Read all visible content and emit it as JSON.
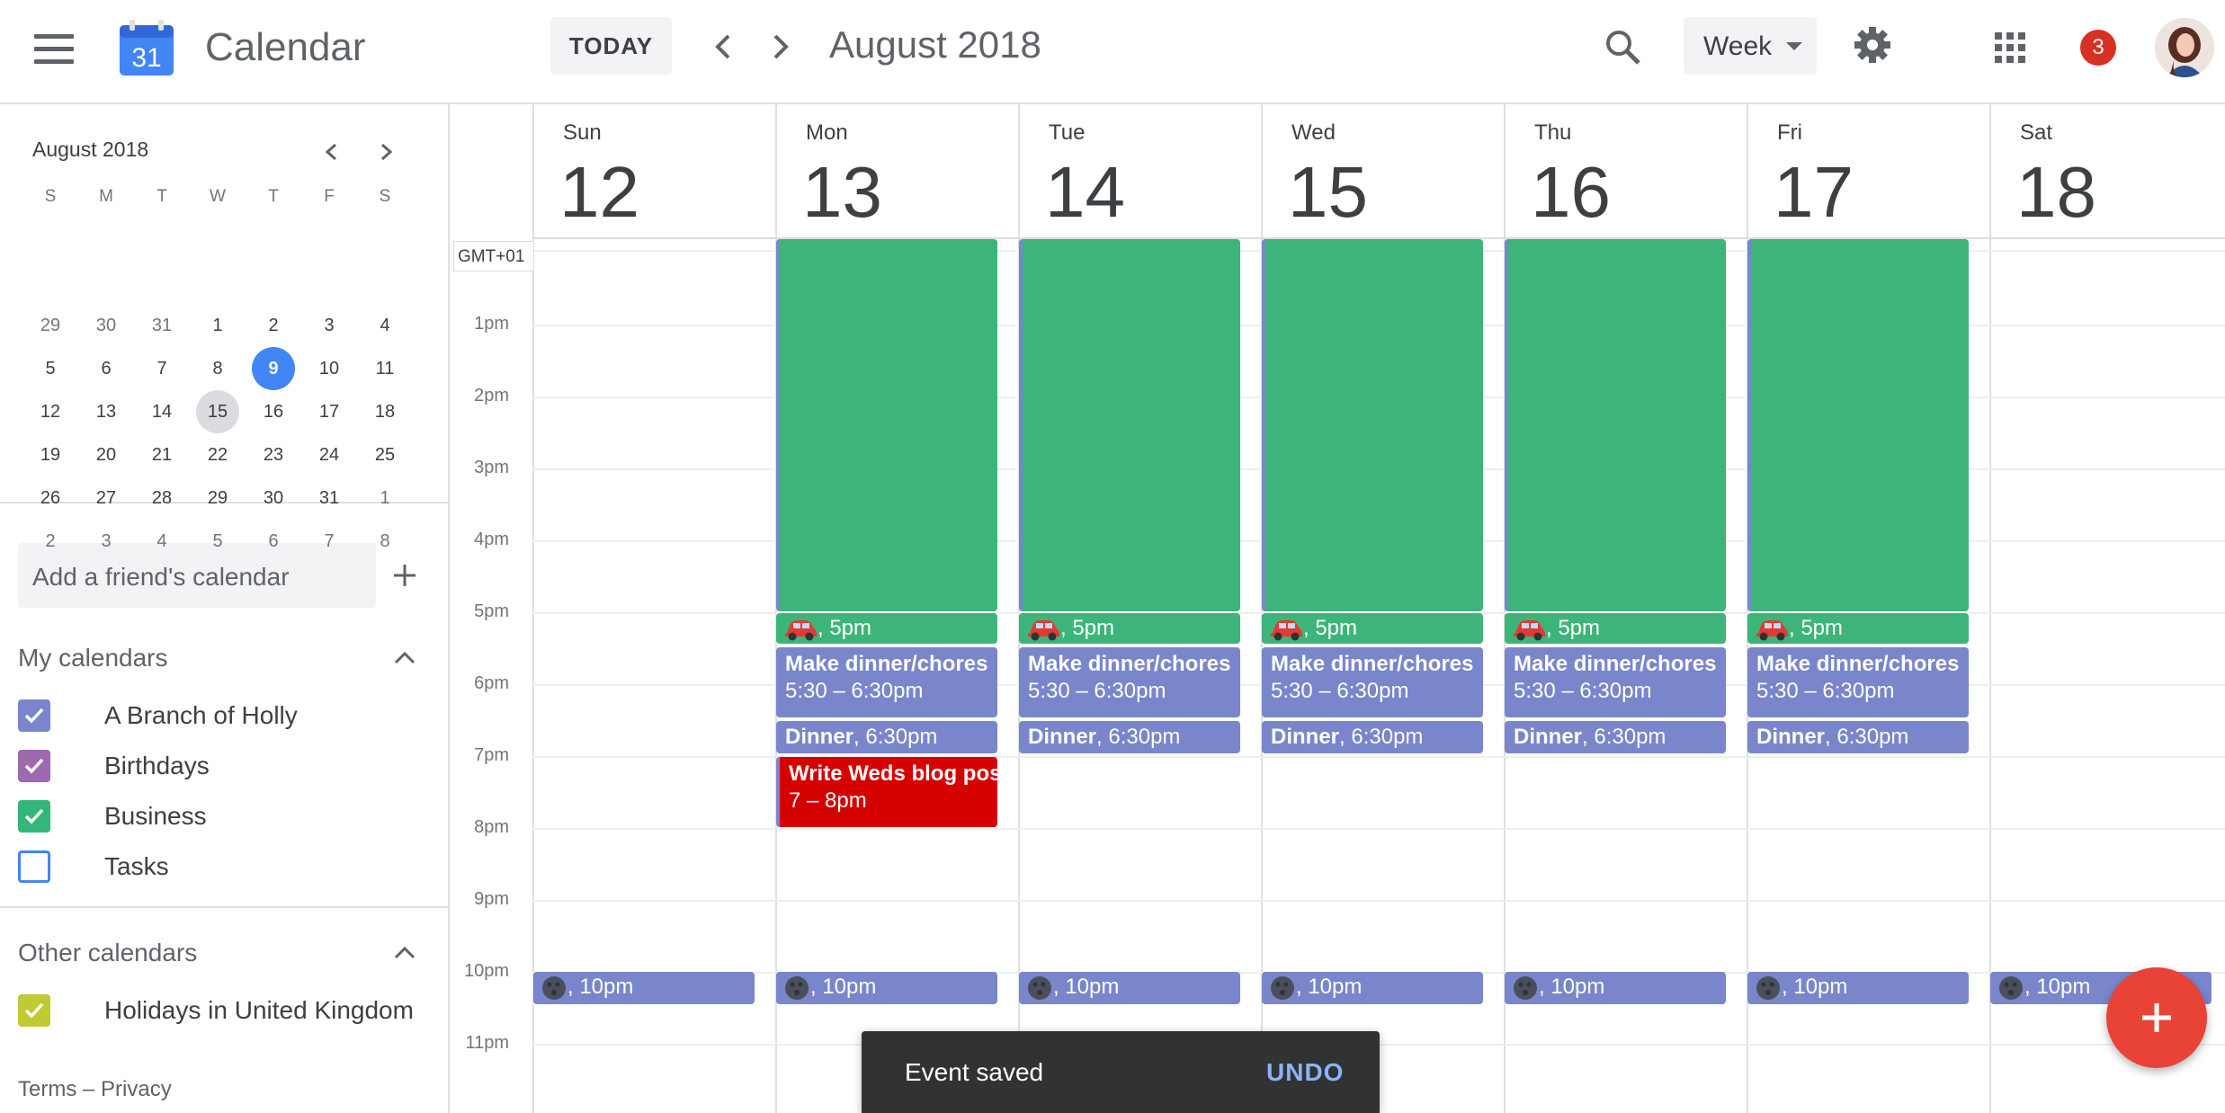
{
  "header": {
    "app_title": "Calendar",
    "logo_day": "31",
    "today_label": "TODAY",
    "date_range": "August 2018",
    "view_selected": "Week",
    "notification_count": "3"
  },
  "sidebar": {
    "mini_calendar": {
      "month_label": "August 2018",
      "weekday_headers": [
        "S",
        "M",
        "T",
        "W",
        "T",
        "F",
        "S"
      ],
      "weeks": [
        [
          "29",
          "30",
          "31",
          "1",
          "2",
          "3",
          "4"
        ],
        [
          "5",
          "6",
          "7",
          "8",
          "9",
          "10",
          "11"
        ],
        [
          "12",
          "13",
          "14",
          "15",
          "16",
          "17",
          "18"
        ],
        [
          "19",
          "20",
          "21",
          "22",
          "23",
          "24",
          "25"
        ],
        [
          "26",
          "27",
          "28",
          "29",
          "30",
          "31",
          "1"
        ],
        [
          "2",
          "3",
          "4",
          "5",
          "6",
          "7",
          "8"
        ]
      ],
      "today": "9",
      "current": "15"
    },
    "add_friend_placeholder": "Add a friend's calendar",
    "my_calendars_title": "My calendars",
    "my_calendars": [
      {
        "label": "A Branch of Holly",
        "color": "#7986cb",
        "checked": true
      },
      {
        "label": "Birthdays",
        "color": "#9e69af",
        "checked": true
      },
      {
        "label": "Business",
        "color": "#33b679",
        "checked": true
      },
      {
        "label": "Tasks",
        "color": "#4285f4",
        "checked": false
      }
    ],
    "other_calendars_title": "Other calendars",
    "other_calendars": [
      {
        "label": "Holidays in United Kingdom",
        "color": "#c0ca33",
        "checked": true
      }
    ],
    "footer": "Terms – Privacy"
  },
  "grid": {
    "timezone": "GMT+01",
    "days": [
      {
        "name": "Sun",
        "num": "12"
      },
      {
        "name": "Mon",
        "num": "13"
      },
      {
        "name": "Tue",
        "num": "14"
      },
      {
        "name": "Wed",
        "num": "15"
      },
      {
        "name": "Thu",
        "num": "16"
      },
      {
        "name": "Fri",
        "num": "17"
      },
      {
        "name": "Sat",
        "num": "18"
      }
    ],
    "hours": [
      "1pm",
      "2pm",
      "3pm",
      "4pm",
      "5pm",
      "6pm",
      "7pm",
      "8pm",
      "9pm",
      "10pm",
      "11pm"
    ],
    "events": {
      "car_time": ", 5pm",
      "chores_title": "Make dinner/chores",
      "chores_time": "5:30 – 6:30pm",
      "dinner_title": "Dinner",
      "dinner_time": ", 6:30pm",
      "blog_title": "Write Weds blog post",
      "blog_time": "7 – 8pm",
      "night_time": ", 10pm"
    }
  },
  "toast": {
    "message": "Event saved",
    "action": "UNDO"
  },
  "colors": {
    "green": "#3db57a",
    "lavender": "#7986cb",
    "red": "#d50000",
    "fab": "#e84336",
    "accent": "#4285f4"
  }
}
